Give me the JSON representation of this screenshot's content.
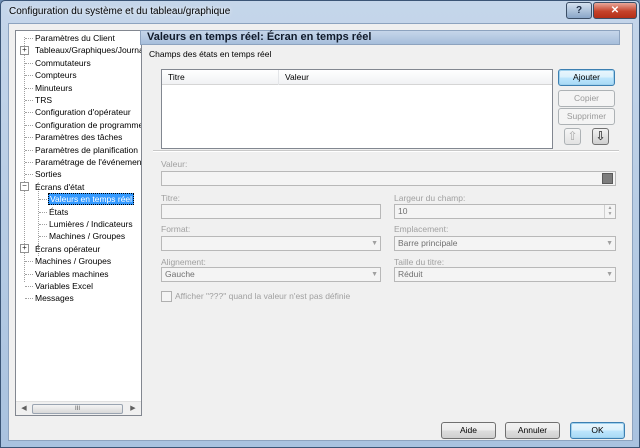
{
  "window": {
    "title": "Configuration du système et du tableau/graphique",
    "help_label": "?",
    "close_label": "✕"
  },
  "tree": {
    "items": [
      {
        "label": "Paramètres du Client",
        "level": 0
      },
      {
        "label": "Tableaux/Graphiques/Journa",
        "level": 0,
        "expander": "+"
      },
      {
        "label": "Commutateurs",
        "level": 0
      },
      {
        "label": "Compteurs",
        "level": 0
      },
      {
        "label": "Minuteurs",
        "level": 0
      },
      {
        "label": "TRS",
        "level": 0
      },
      {
        "label": "Configuration d'opérateur",
        "level": 0
      },
      {
        "label": "Configuration de programme",
        "level": 0
      },
      {
        "label": "Paramètres des tâches",
        "level": 0
      },
      {
        "label": "Paramètres de planification",
        "level": 0
      },
      {
        "label": "Paramétrage de l'événement",
        "level": 0
      },
      {
        "label": "Sorties",
        "level": 0
      },
      {
        "label": "Écrans d'état",
        "level": 0,
        "expander": "−"
      },
      {
        "label": "Valeurs en temps réel",
        "level": 1,
        "selected": true
      },
      {
        "label": "États",
        "level": 1
      },
      {
        "label": "Lumières / Indicateurs",
        "level": 1
      },
      {
        "label": "Machines / Groupes",
        "level": 1
      },
      {
        "label": "Écrans opérateur",
        "level": 0,
        "expander": "+"
      },
      {
        "label": "Machines / Groupes",
        "level": 0
      },
      {
        "label": "Variables machines",
        "level": 0
      },
      {
        "label": "Variables Excel",
        "level": 0
      },
      {
        "label": "Messages",
        "level": 0
      }
    ],
    "scroll_left": "◀",
    "scroll_right": "▶",
    "scroll_grip": "III"
  },
  "panel": {
    "header": "Valeurs en temps réel: Écran en temps réel",
    "section_label": "Champs des états en temps réel",
    "columns": [
      "Titre",
      "Valeur"
    ],
    "buttons": {
      "add": "Ajouter",
      "copy": "Copier",
      "delete": "Supprimer",
      "up": "⇧",
      "down": "⇩"
    }
  },
  "form": {
    "valeur_label": "Valeur:",
    "valeur_value": "",
    "titre_label": "Titre:",
    "titre_value": "",
    "largeur_label": "Largeur du champ:",
    "largeur_value": "10",
    "format_label": "Format:",
    "format_value": "",
    "emplacement_label": "Emplacement:",
    "emplacement_value": "Barre principale",
    "alignement_label": "Alignement:",
    "alignement_value": "Gauche",
    "taille_label": "Taille du titre:",
    "taille_value": "Réduit",
    "checkbox_label": "Afficher \"???\" quand la valeur n'est pas définie"
  },
  "footer": {
    "help": "Aide",
    "cancel": "Annuler",
    "ok": "OK"
  }
}
